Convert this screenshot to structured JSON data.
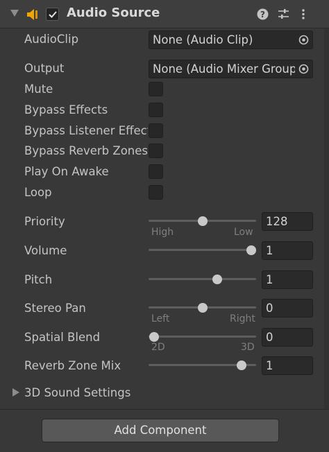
{
  "component": {
    "title": "Audio Source",
    "enabled": true,
    "icons": [
      "audio-source-icon",
      "help-icon",
      "preset-icon",
      "context-menu-icon"
    ]
  },
  "fields": {
    "audio_clip": {
      "label": "AudioClip",
      "value": "None (Audio Clip)"
    },
    "output": {
      "label": "Output",
      "value": "None (Audio Mixer Group)"
    },
    "mute": {
      "label": "Mute",
      "checked": false
    },
    "bypass_effects": {
      "label": "Bypass Effects",
      "checked": false
    },
    "bypass_listener_effects": {
      "label": "Bypass Listener Effects",
      "checked": false
    },
    "bypass_reverb_zones": {
      "label": "Bypass Reverb Zones",
      "checked": false
    },
    "play_on_awake": {
      "label": "Play On Awake",
      "checked": false
    },
    "loop": {
      "label": "Loop",
      "checked": false
    }
  },
  "sliders": {
    "priority": {
      "label": "Priority",
      "value": "128",
      "min_label": "High",
      "max_label": "Low",
      "fraction": 0.5
    },
    "volume": {
      "label": "Volume",
      "value": "1",
      "fraction": 1.0
    },
    "pitch": {
      "label": "Pitch",
      "value": "1",
      "fraction": 0.65
    },
    "stereo_pan": {
      "label": "Stereo Pan",
      "value": "0",
      "min_label": "Left",
      "max_label": "Right",
      "fraction": 0.5
    },
    "spatial_blend": {
      "label": "Spatial Blend",
      "value": "0",
      "min_label": "2D",
      "max_label": "3D",
      "fraction": 0.0
    },
    "reverb_zone_mix": {
      "label": "Reverb Zone Mix",
      "value": "1",
      "fraction": 0.9
    }
  },
  "sound_settings": {
    "label": "3D Sound Settings",
    "expanded": false
  },
  "add_component": {
    "label": "Add Component"
  },
  "colors": {
    "background": "#383838",
    "field": "#292929",
    "thumb": "#c9c9c9",
    "speaker": "#f0a500"
  }
}
